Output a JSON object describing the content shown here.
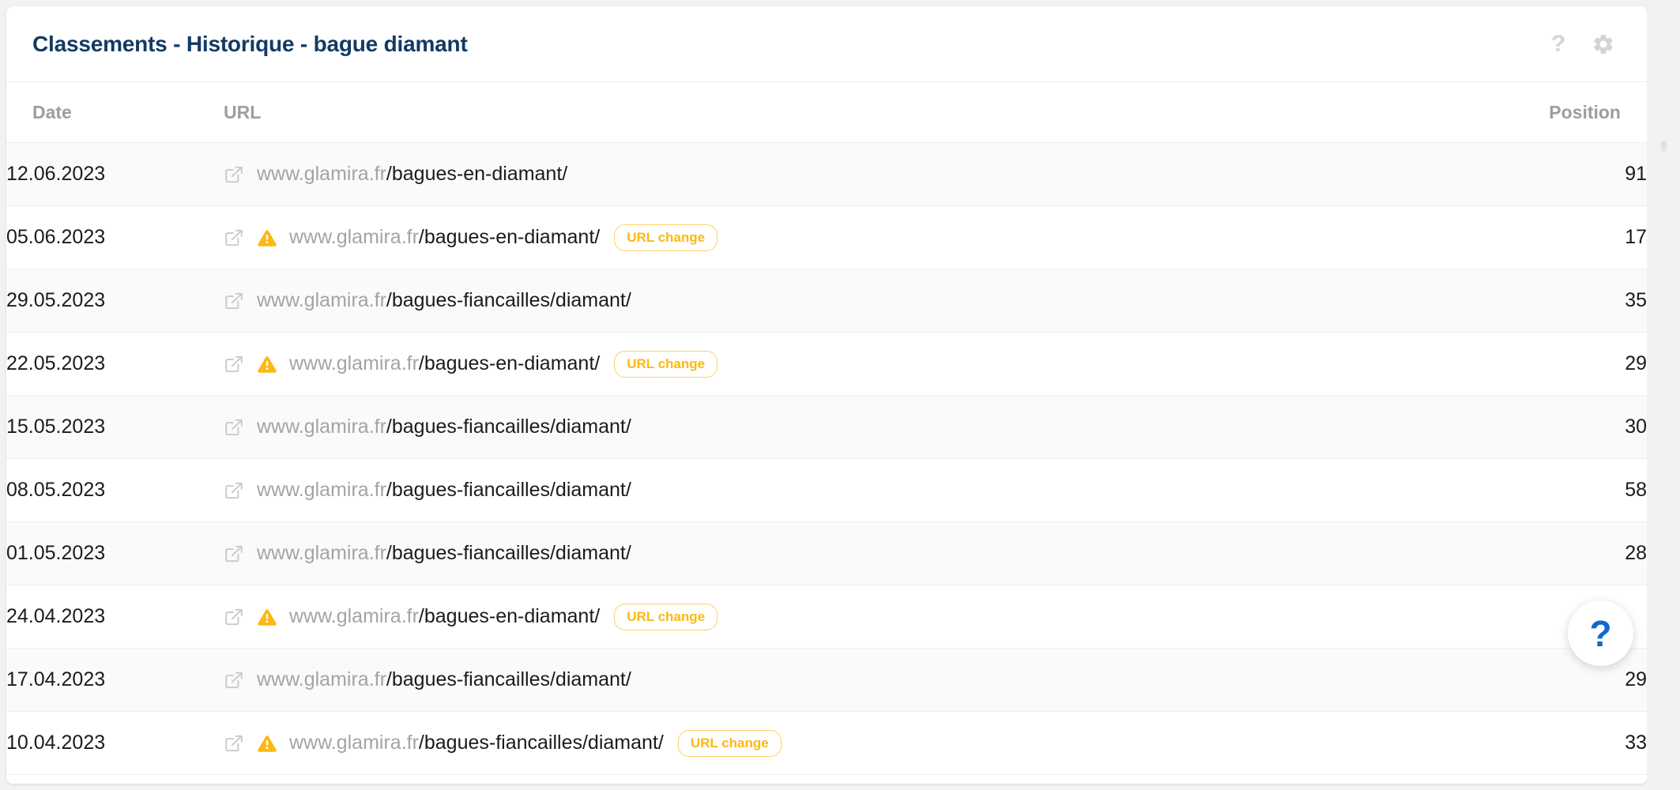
{
  "card": {
    "title": "Classements - Historique - bague diamant",
    "header_icons": [
      {
        "name": "help-icon",
        "glyph": "?"
      },
      {
        "name": "settings-gear-icon",
        "glyph": "gear"
      }
    ]
  },
  "table": {
    "columns": {
      "date": "Date",
      "url": "URL",
      "position": "Position"
    },
    "rows": [
      {
        "date": "12.06.2023",
        "domain": "www.glamira.fr",
        "path": "/bagues-en-diamant/",
        "warning": false,
        "badge": "",
        "position": "91"
      },
      {
        "date": "05.06.2023",
        "domain": "www.glamira.fr",
        "path": "/bagues-en-diamant/",
        "warning": true,
        "badge": "URL change",
        "position": "17"
      },
      {
        "date": "29.05.2023",
        "domain": "www.glamira.fr",
        "path": "/bagues-fiancailles/diamant/",
        "warning": false,
        "badge": "",
        "position": "35"
      },
      {
        "date": "22.05.2023",
        "domain": "www.glamira.fr",
        "path": "/bagues-en-diamant/",
        "warning": true,
        "badge": "URL change",
        "position": "29"
      },
      {
        "date": "15.05.2023",
        "domain": "www.glamira.fr",
        "path": "/bagues-fiancailles/diamant/",
        "warning": false,
        "badge": "",
        "position": "30"
      },
      {
        "date": "08.05.2023",
        "domain": "www.glamira.fr",
        "path": "/bagues-fiancailles/diamant/",
        "warning": false,
        "badge": "",
        "position": "58"
      },
      {
        "date": "01.05.2023",
        "domain": "www.glamira.fr",
        "path": "/bagues-fiancailles/diamant/",
        "warning": false,
        "badge": "",
        "position": "28"
      },
      {
        "date": "24.04.2023",
        "domain": "www.glamira.fr",
        "path": "/bagues-en-diamant/",
        "warning": true,
        "badge": "URL change",
        "position": ""
      },
      {
        "date": "17.04.2023",
        "domain": "www.glamira.fr",
        "path": "/bagues-fiancailles/diamant/",
        "warning": false,
        "badge": "",
        "position": "29"
      },
      {
        "date": "10.04.2023",
        "domain": "www.glamira.fr",
        "path": "/bagues-fiancailles/diamant/",
        "warning": true,
        "badge": "URL change",
        "position": "33"
      }
    ]
  },
  "floating_help": {
    "label": "?"
  },
  "colors": {
    "title": "#133a64",
    "badge_text": "#fcb814",
    "badge_border": "#fcd265",
    "warning": "#fcb814",
    "help_blue": "#1169d0",
    "muted": "#9b9ea1"
  }
}
